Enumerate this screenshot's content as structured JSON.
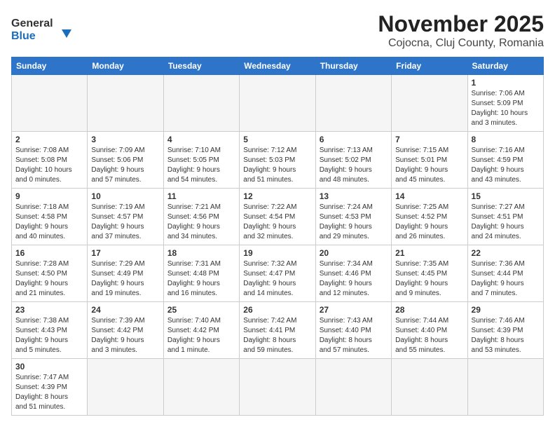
{
  "header": {
    "logo_general": "General",
    "logo_blue": "Blue",
    "title": "November 2025",
    "subtitle": "Cojocna, Cluj County, Romania"
  },
  "weekdays": [
    "Sunday",
    "Monday",
    "Tuesday",
    "Wednesday",
    "Thursday",
    "Friday",
    "Saturday"
  ],
  "weeks": [
    [
      {
        "day": "",
        "info": ""
      },
      {
        "day": "",
        "info": ""
      },
      {
        "day": "",
        "info": ""
      },
      {
        "day": "",
        "info": ""
      },
      {
        "day": "",
        "info": ""
      },
      {
        "day": "",
        "info": ""
      },
      {
        "day": "1",
        "info": "Sunrise: 7:06 AM\nSunset: 5:09 PM\nDaylight: 10 hours\nand 3 minutes."
      }
    ],
    [
      {
        "day": "2",
        "info": "Sunrise: 7:08 AM\nSunset: 5:08 PM\nDaylight: 10 hours\nand 0 minutes."
      },
      {
        "day": "3",
        "info": "Sunrise: 7:09 AM\nSunset: 5:06 PM\nDaylight: 9 hours\nand 57 minutes."
      },
      {
        "day": "4",
        "info": "Sunrise: 7:10 AM\nSunset: 5:05 PM\nDaylight: 9 hours\nand 54 minutes."
      },
      {
        "day": "5",
        "info": "Sunrise: 7:12 AM\nSunset: 5:03 PM\nDaylight: 9 hours\nand 51 minutes."
      },
      {
        "day": "6",
        "info": "Sunrise: 7:13 AM\nSunset: 5:02 PM\nDaylight: 9 hours\nand 48 minutes."
      },
      {
        "day": "7",
        "info": "Sunrise: 7:15 AM\nSunset: 5:01 PM\nDaylight: 9 hours\nand 45 minutes."
      },
      {
        "day": "8",
        "info": "Sunrise: 7:16 AM\nSunset: 4:59 PM\nDaylight: 9 hours\nand 43 minutes."
      }
    ],
    [
      {
        "day": "9",
        "info": "Sunrise: 7:18 AM\nSunset: 4:58 PM\nDaylight: 9 hours\nand 40 minutes."
      },
      {
        "day": "10",
        "info": "Sunrise: 7:19 AM\nSunset: 4:57 PM\nDaylight: 9 hours\nand 37 minutes."
      },
      {
        "day": "11",
        "info": "Sunrise: 7:21 AM\nSunset: 4:56 PM\nDaylight: 9 hours\nand 34 minutes."
      },
      {
        "day": "12",
        "info": "Sunrise: 7:22 AM\nSunset: 4:54 PM\nDaylight: 9 hours\nand 32 minutes."
      },
      {
        "day": "13",
        "info": "Sunrise: 7:24 AM\nSunset: 4:53 PM\nDaylight: 9 hours\nand 29 minutes."
      },
      {
        "day": "14",
        "info": "Sunrise: 7:25 AM\nSunset: 4:52 PM\nDaylight: 9 hours\nand 26 minutes."
      },
      {
        "day": "15",
        "info": "Sunrise: 7:27 AM\nSunset: 4:51 PM\nDaylight: 9 hours\nand 24 minutes."
      }
    ],
    [
      {
        "day": "16",
        "info": "Sunrise: 7:28 AM\nSunset: 4:50 PM\nDaylight: 9 hours\nand 21 minutes."
      },
      {
        "day": "17",
        "info": "Sunrise: 7:29 AM\nSunset: 4:49 PM\nDaylight: 9 hours\nand 19 minutes."
      },
      {
        "day": "18",
        "info": "Sunrise: 7:31 AM\nSunset: 4:48 PM\nDaylight: 9 hours\nand 16 minutes."
      },
      {
        "day": "19",
        "info": "Sunrise: 7:32 AM\nSunset: 4:47 PM\nDaylight: 9 hours\nand 14 minutes."
      },
      {
        "day": "20",
        "info": "Sunrise: 7:34 AM\nSunset: 4:46 PM\nDaylight: 9 hours\nand 12 minutes."
      },
      {
        "day": "21",
        "info": "Sunrise: 7:35 AM\nSunset: 4:45 PM\nDaylight: 9 hours\nand 9 minutes."
      },
      {
        "day": "22",
        "info": "Sunrise: 7:36 AM\nSunset: 4:44 PM\nDaylight: 9 hours\nand 7 minutes."
      }
    ],
    [
      {
        "day": "23",
        "info": "Sunrise: 7:38 AM\nSunset: 4:43 PM\nDaylight: 9 hours\nand 5 minutes."
      },
      {
        "day": "24",
        "info": "Sunrise: 7:39 AM\nSunset: 4:42 PM\nDaylight: 9 hours\nand 3 minutes."
      },
      {
        "day": "25",
        "info": "Sunrise: 7:40 AM\nSunset: 4:42 PM\nDaylight: 9 hours\nand 1 minute."
      },
      {
        "day": "26",
        "info": "Sunrise: 7:42 AM\nSunset: 4:41 PM\nDaylight: 8 hours\nand 59 minutes."
      },
      {
        "day": "27",
        "info": "Sunrise: 7:43 AM\nSunset: 4:40 PM\nDaylight: 8 hours\nand 57 minutes."
      },
      {
        "day": "28",
        "info": "Sunrise: 7:44 AM\nSunset: 4:40 PM\nDaylight: 8 hours\nand 55 minutes."
      },
      {
        "day": "29",
        "info": "Sunrise: 7:46 AM\nSunset: 4:39 PM\nDaylight: 8 hours\nand 53 minutes."
      }
    ],
    [
      {
        "day": "30",
        "info": "Sunrise: 7:47 AM\nSunset: 4:39 PM\nDaylight: 8 hours\nand 51 minutes."
      },
      {
        "day": "",
        "info": ""
      },
      {
        "day": "",
        "info": ""
      },
      {
        "day": "",
        "info": ""
      },
      {
        "day": "",
        "info": ""
      },
      {
        "day": "",
        "info": ""
      },
      {
        "day": "",
        "info": ""
      }
    ]
  ]
}
